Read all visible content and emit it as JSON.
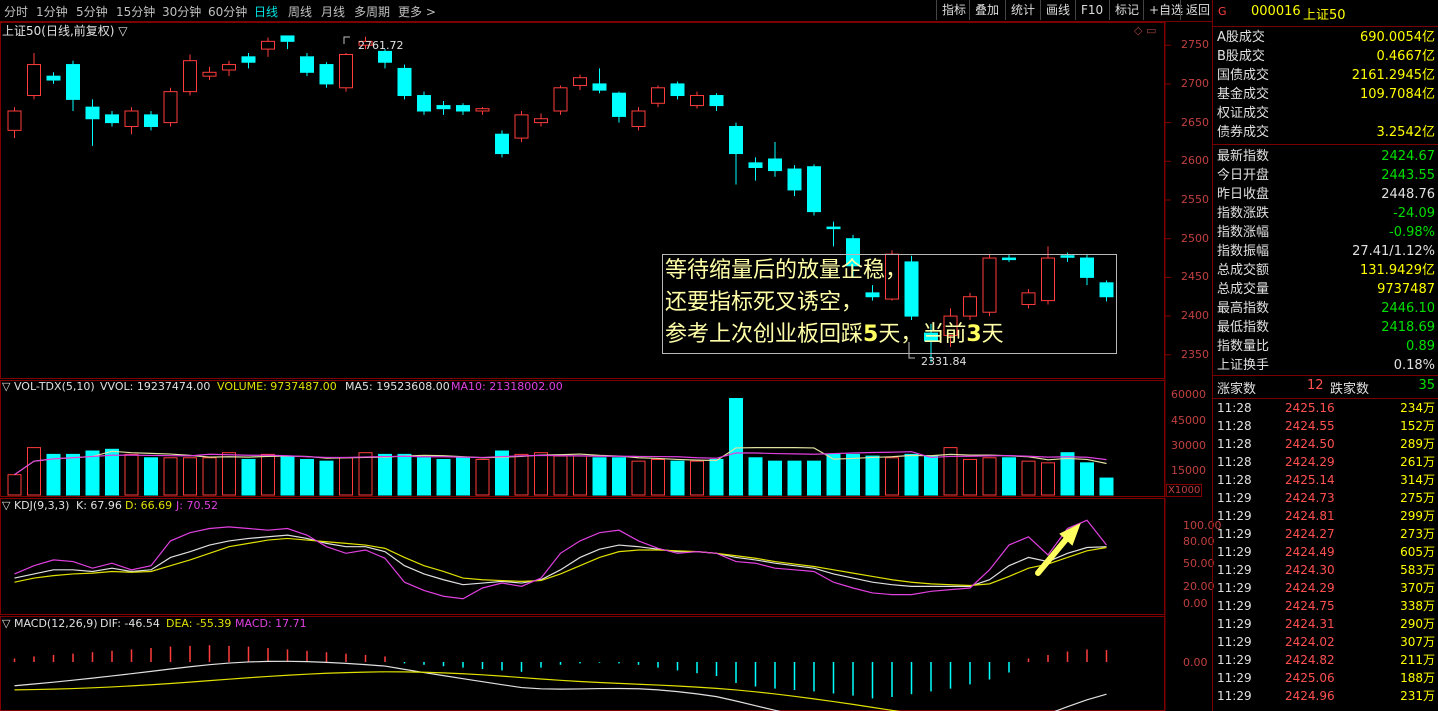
{
  "toolbar": {
    "periods": [
      "分时",
      "1分钟",
      "5分钟",
      "15分钟",
      "30分钟",
      "60分钟",
      "日线",
      "周线",
      "月线",
      "多周期",
      "更多 >"
    ],
    "active_period": "日线",
    "tools": [
      "指标",
      "叠加",
      "统计",
      "画线",
      "F10",
      "标记",
      "+自选",
      "返回"
    ]
  },
  "main_panel": {
    "title": "上证50(日线,前复权) ▽",
    "price_axis": [
      "2750",
      "2700",
      "2650",
      "2600",
      "2550",
      "2500",
      "2450",
      "2400",
      "2350"
    ],
    "high_label": "2761.72",
    "low_label": "2331.84",
    "annotation": {
      "line1": "等待缩量后的放量企稳，",
      "line2": "还要指标死叉诱空，",
      "line3_a": "参考上次创业板回踩",
      "line3_n1": "5",
      "line3_b": "天，当前",
      "line3_n2": "3",
      "line3_c": "天"
    }
  },
  "vol_panel": {
    "name": "▽ VOL-TDX(5,10)",
    "vvol": "VVOL: 19237474.00",
    "volume": "VOLUME: 9737487.00",
    "ma5": "MA5: 19523608.00",
    "ma10": "MA10: 21318002.00",
    "axis": [
      "60000",
      "45000",
      "30000",
      "15000"
    ],
    "unit": "X1000"
  },
  "kdj_panel": {
    "name": "▽ KDJ(9,3,3)",
    "k": "K: 67.96",
    "d": "D: 66.69",
    "j": "J: 70.52",
    "axis": [
      "100.00",
      "80.00",
      "50.00",
      "20.00",
      "0.00"
    ]
  },
  "macd_panel": {
    "name": "▽ MACD(12,26,9)",
    "dif": "DIF: -46.54",
    "dea": "DEA: -55.39",
    "macd": "MACD: 17.71",
    "axis": [
      "0.00"
    ]
  },
  "quote": {
    "code": "000016",
    "name": "上证50",
    "logo": "G",
    "rows1": [
      {
        "k": "A股成交",
        "v": "690.0054亿",
        "c": "#ffff00"
      },
      {
        "k": "B股成交",
        "v": "0.4667亿",
        "c": "#ffff00"
      },
      {
        "k": "国债成交",
        "v": "2161.2945亿",
        "c": "#ffff00"
      },
      {
        "k": "基金成交",
        "v": "109.7084亿",
        "c": "#ffff00"
      },
      {
        "k": "权证成交",
        "v": "",
        "c": "#ffff00"
      },
      {
        "k": "债券成交",
        "v": "3.2542亿",
        "c": "#ffff00"
      }
    ],
    "rows2": [
      {
        "k": "最新指数",
        "v": "2424.67",
        "c": "#00e000"
      },
      {
        "k": "今日开盘",
        "v": "2443.55",
        "c": "#00e000"
      },
      {
        "k": "昨日收盘",
        "v": "2448.76",
        "c": "#e0e0e0"
      },
      {
        "k": "指数涨跌",
        "v": "-24.09",
        "c": "#00e000"
      },
      {
        "k": "指数涨幅",
        "v": "-0.98%",
        "c": "#00e000"
      },
      {
        "k": "指数振幅",
        "v": "27.41/1.12%",
        "c": "#e0e0e0"
      },
      {
        "k": "总成交额",
        "v": "131.9429亿",
        "c": "#ffff00"
      },
      {
        "k": "总成交量",
        "v": "9737487",
        "c": "#ffff00"
      },
      {
        "k": "最高指数",
        "v": "2446.10",
        "c": "#00e000"
      },
      {
        "k": "最低指数",
        "v": "2418.69",
        "c": "#00e000"
      },
      {
        "k": "指数量比",
        "v": "0.89",
        "c": "#00e000"
      },
      {
        "k": "上证换手",
        "v": "0.18%",
        "c": "#e0e0e0"
      }
    ],
    "up_label": "涨家数",
    "up_count": "12",
    "down_label": "跌家数",
    "down_count": "35",
    "ticks": [
      {
        "t": "11:28",
        "p": "2425.16",
        "q": "234万"
      },
      {
        "t": "11:28",
        "p": "2424.55",
        "q": "152万"
      },
      {
        "t": "11:28",
        "p": "2424.50",
        "q": "289万"
      },
      {
        "t": "11:28",
        "p": "2424.29",
        "q": "261万"
      },
      {
        "t": "11:28",
        "p": "2425.14",
        "q": "314万"
      },
      {
        "t": "11:29",
        "p": "2424.73",
        "q": "275万"
      },
      {
        "t": "11:29",
        "p": "2424.81",
        "q": "299万"
      },
      {
        "t": "11:29",
        "p": "2424.27",
        "q": "273万"
      },
      {
        "t": "11:29",
        "p": "2424.49",
        "q": "605万"
      },
      {
        "t": "11:29",
        "p": "2424.30",
        "q": "583万"
      },
      {
        "t": "11:29",
        "p": "2424.29",
        "q": "370万"
      },
      {
        "t": "11:29",
        "p": "2424.75",
        "q": "338万"
      },
      {
        "t": "11:29",
        "p": "2424.31",
        "q": "290万"
      },
      {
        "t": "11:29",
        "p": "2424.02",
        "q": "307万"
      },
      {
        "t": "11:29",
        "p": "2424.82",
        "q": "211万"
      },
      {
        "t": "11:29",
        "p": "2425.06",
        "q": "188万"
      },
      {
        "t": "11:29",
        "p": "2424.96",
        "q": "231万"
      }
    ]
  },
  "chart_data": {
    "type": "candlestick",
    "title": "上证50(日线,前复权)",
    "ylim": [
      2320,
      2780
    ],
    "candles": [
      [
        2640,
        2665,
        2630,
        2670
      ],
      [
        2685,
        2725,
        2680,
        2740
      ],
      [
        2710,
        2705,
        2700,
        2715
      ],
      [
        2725,
        2680,
        2665,
        2730
      ],
      [
        2670,
        2655,
        2620,
        2680
      ],
      [
        2660,
        2650,
        2645,
        2665
      ],
      [
        2645,
        2665,
        2635,
        2670
      ],
      [
        2660,
        2645,
        2640,
        2665
      ],
      [
        2650,
        2690,
        2645,
        2695
      ],
      [
        2690,
        2730,
        2685,
        2738
      ],
      [
        2710,
        2715,
        2705,
        2722
      ],
      [
        2718,
        2725,
        2710,
        2730
      ],
      [
        2735,
        2728,
        2720,
        2740
      ],
      [
        2745,
        2755,
        2735,
        2760
      ],
      [
        2762,
        2755,
        2745,
        2762
      ],
      [
        2735,
        2715,
        2710,
        2740
      ],
      [
        2725,
        2700,
        2695,
        2728
      ],
      [
        2695,
        2738,
        2690,
        2740
      ],
      [
        2750,
        2755,
        2745,
        2761
      ],
      [
        2742,
        2728,
        2720,
        2745
      ],
      [
        2720,
        2685,
        2680,
        2725
      ],
      [
        2685,
        2665,
        2660,
        2690
      ],
      [
        2672,
        2668,
        2660,
        2678
      ],
      [
        2672,
        2665,
        2660,
        2675
      ],
      [
        2665,
        2668,
        2660,
        2670
      ],
      [
        2635,
        2610,
        2605,
        2640
      ],
      [
        2630,
        2660,
        2625,
        2665
      ],
      [
        2650,
        2655,
        2645,
        2662
      ],
      [
        2665,
        2695,
        2660,
        2698
      ],
      [
        2698,
        2708,
        2692,
        2712
      ],
      [
        2700,
        2692,
        2688,
        2720
      ],
      [
        2688,
        2658,
        2650,
        2690
      ],
      [
        2645,
        2665,
        2640,
        2670
      ],
      [
        2675,
        2695,
        2670,
        2698
      ],
      [
        2700,
        2685,
        2680,
        2703
      ],
      [
        2672,
        2685,
        2668,
        2690
      ],
      [
        2685,
        2672,
        2665,
        2688
      ],
      [
        2645,
        2610,
        2570,
        2650
      ],
      [
        2598,
        2592,
        2575,
        2605
      ],
      [
        2603,
        2588,
        2580,
        2625
      ],
      [
        2590,
        2563,
        2555,
        2595
      ],
      [
        2593,
        2535,
        2530,
        2596
      ],
      [
        2515,
        2513,
        2490,
        2522
      ],
      [
        2500,
        2465,
        2450,
        2505
      ],
      [
        2430,
        2425,
        2420,
        2440
      ],
      [
        2422,
        2480,
        2420,
        2485
      ],
      [
        2470,
        2400,
        2395,
        2478
      ],
      [
        2378,
        2368,
        2340,
        2390
      ],
      [
        2375,
        2400,
        2360,
        2410
      ],
      [
        2400,
        2425,
        2395,
        2430
      ],
      [
        2405,
        2475,
        2400,
        2480
      ],
      [
        2475,
        2473,
        2470,
        2480
      ],
      [
        2415,
        2430,
        2410,
        2435
      ],
      [
        2420,
        2475,
        2415,
        2490
      ],
      [
        2478,
        2476,
        2470,
        2482
      ],
      [
        2475,
        2450,
        2440,
        2480
      ],
      [
        2443,
        2425,
        2419,
        2446
      ]
    ],
    "volume": [
      12,
      28,
      24,
      24,
      26,
      27,
      24,
      22,
      22,
      22,
      22,
      25,
      21,
      24,
      23,
      21,
      20,
      22,
      25,
      24,
      24,
      22,
      21,
      22,
      21,
      26,
      24,
      25,
      23,
      23,
      22,
      22,
      20,
      21,
      20,
      20,
      21,
      57,
      22,
      20,
      20,
      20,
      24,
      24,
      23,
      22,
      24,
      23,
      28,
      21,
      22,
      22,
      20,
      19,
      25,
      19,
      10
    ],
    "kdj": {
      "k": [
        30,
        35,
        40,
        40,
        38,
        42,
        38,
        40,
        55,
        62,
        70,
        75,
        78,
        80,
        82,
        78,
        72,
        68,
        68,
        62,
        45,
        35,
        28,
        22,
        24,
        26,
        24,
        28,
        40,
        55,
        65,
        70,
        68,
        65,
        62,
        62,
        60,
        55,
        52,
        48,
        45,
        42,
        35,
        30,
        25,
        22,
        20,
        20,
        20,
        20,
        28,
        45,
        55,
        50,
        60,
        67,
        68
      ],
      "d": [
        25,
        30,
        33,
        35,
        36,
        38,
        37,
        38,
        45,
        52,
        60,
        68,
        72,
        76,
        78,
        76,
        74,
        72,
        70,
        66,
        55,
        45,
        38,
        30,
        28,
        27,
        26,
        27,
        35,
        45,
        55,
        62,
        64,
        64,
        63,
        62,
        60,
        57,
        54,
        50,
        47,
        44,
        40,
        36,
        32,
        28,
        25,
        23,
        22,
        21,
        23,
        32,
        42,
        47,
        55,
        63,
        67
      ],
      "j": [
        35,
        45,
        52,
        50,
        42,
        48,
        40,
        45,
        75,
        85,
        90,
        92,
        90,
        88,
        90,
        82,
        68,
        60,
        64,
        54,
        25,
        15,
        8,
        5,
        18,
        24,
        20,
        30,
        60,
        75,
        85,
        88,
        75,
        66,
        60,
        62,
        60,
        50,
        48,
        42,
        40,
        38,
        25,
        18,
        12,
        10,
        10,
        14,
        16,
        18,
        40,
        70,
        80,
        58,
        90,
        100,
        70
      ]
    },
    "macd": {
      "hist": [
        5,
        8,
        10,
        12,
        14,
        16,
        18,
        20,
        22,
        23,
        24,
        23,
        22,
        20,
        18,
        16,
        14,
        12,
        10,
        8,
        -2,
        -4,
        -6,
        -8,
        -10,
        -12,
        -14,
        -8,
        -4,
        -2,
        -1,
        -2,
        -4,
        -8,
        -12,
        -16,
        -20,
        -30,
        -35,
        -38,
        -40,
        -42,
        -45,
        -48,
        -52,
        -50,
        -46,
        -42,
        -38,
        -32,
        -25,
        -15,
        5,
        10,
        15,
        18,
        17
      ]
    }
  }
}
